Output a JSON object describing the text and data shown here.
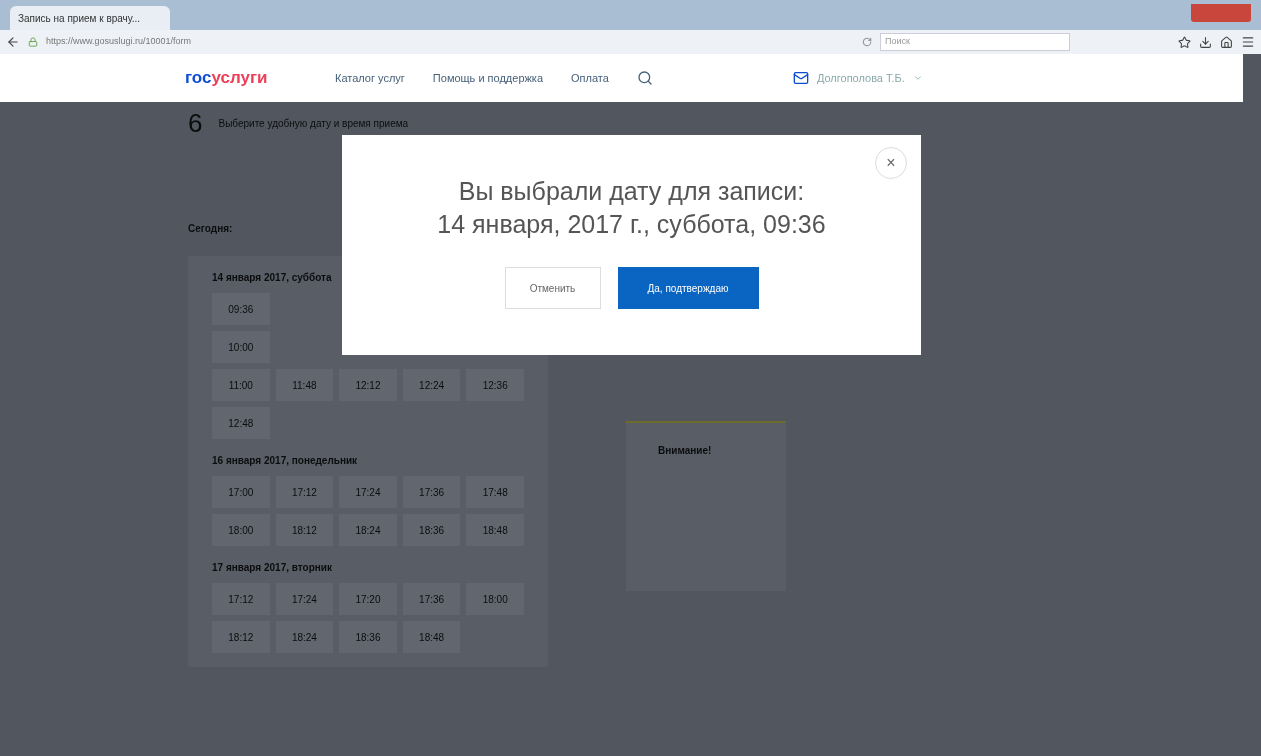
{
  "browser": {
    "tab_title": "Запись на прием к врачу...",
    "url": "https://www.gosuslugi.ru/10001/form",
    "search_placeholder": "Поиск"
  },
  "header": {
    "logo_part1": "гос",
    "logo_part2": "услуги",
    "nav": [
      "Каталог услуг",
      "Помощь и поддержка",
      "Оплата"
    ],
    "user": "Долгополова Т.Б."
  },
  "step": {
    "number": "6",
    "title": "Выберите удобную дату и время приема"
  },
  "today_label": "Сегодня:",
  "days": [
    {
      "title": "14 января 2017, суббота",
      "rows": [
        [
          "09:36"
        ],
        [
          "10:00"
        ],
        [
          "11:00",
          "11:48",
          "12:12",
          "12:24",
          "12:36"
        ],
        [
          "12:48"
        ]
      ]
    },
    {
      "title": "16 января 2017, понедельник",
      "rows": [
        [
          "17:00",
          "17:12",
          "17:24",
          "17:36",
          "17:48"
        ],
        [
          "18:00",
          "18:12",
          "18:24",
          "18:36",
          "18:48"
        ]
      ]
    },
    {
      "title": "17 января 2017, вторник",
      "rows": [
        [
          "17:12",
          "17:24",
          "17:20",
          "17:36",
          "18:00"
        ],
        [
          "18:12",
          "18:24",
          "18:36",
          "18:48"
        ]
      ]
    }
  ],
  "notice": {
    "title": "Внимание!"
  },
  "dialog": {
    "line1": "Вы выбрали дату для записи:",
    "line2": "14 января, 2017 г., суббота, 09:36",
    "cancel": "Отменить",
    "confirm": "Да, подтверждаю",
    "close": "×"
  }
}
